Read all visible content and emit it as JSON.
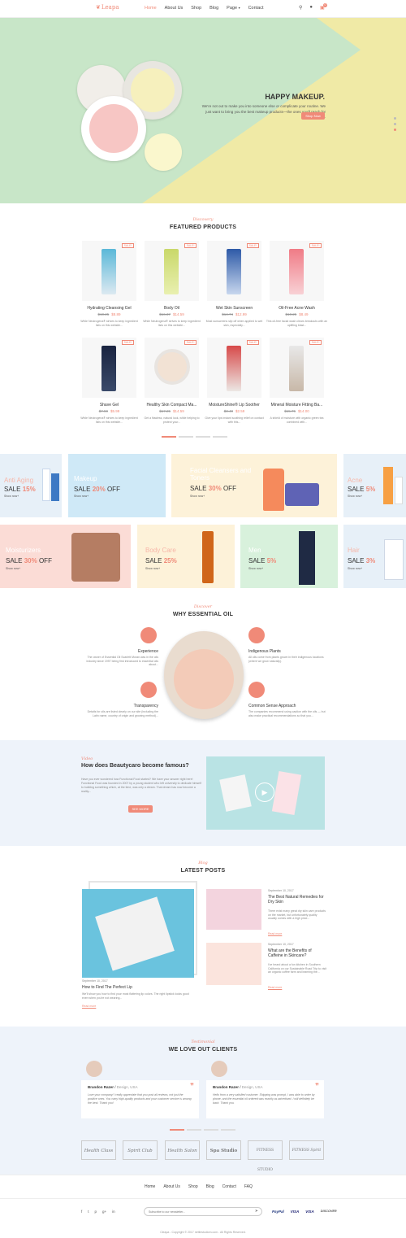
{
  "header": {
    "logo": "Leapa",
    "nav": [
      "Home",
      "About Us",
      "Shop",
      "Blog",
      "Page",
      "Contact"
    ],
    "cart_count": "0"
  },
  "hero": {
    "title": "HAPPY MAKEUP.",
    "text": "We're not out to make you into someone else or complicate your routine. We just want to bring you the best makeup products—the ones you'll reach for every day.",
    "button": "Shop Now"
  },
  "featured": {
    "script": "Discovery",
    "title": "FEATURED PRODUCTS",
    "products": [
      {
        "name": "Hydrating Cleansing Gel",
        "old": "$10.25",
        "price": "$8.89",
        "desc": "While Neutrogena® strives to keep ingredient lists on this website...",
        "sale": "SALE!"
      },
      {
        "name": "Body Oil",
        "old": "$16.37",
        "price": "$14.59",
        "desc": "While Neutrogena® strives to keep ingredient lists on this website...",
        "sale": "SALE!"
      },
      {
        "name": "Wet Skin Sunscreen",
        "old": "$14.74",
        "price": "$12.99",
        "desc": "Most sunscreens slip off when applied to wet skin, especially...",
        "sale": "SALE!"
      },
      {
        "name": "Oil-Free Acne Wash",
        "old": "$10.25",
        "price": "$8.49",
        "desc": "This oil-free facial wash clears breakouts with an uplifting blast...",
        "sale": "SALE!"
      },
      {
        "name": "Shave Gel",
        "old": "$7.59",
        "price": "$5.99",
        "desc": "While Neutrogena® strives to keep ingredient lists on this website...",
        "sale": "SALE!"
      },
      {
        "name": "Healthy Skin Compact Ma...",
        "old": "$17.25",
        "price": "$14.59",
        "desc": "Get a flawless, natural look, while helping to protect your...",
        "sale": "SALE!"
      },
      {
        "name": "MoistureShine® Lip Soother",
        "old": "$3.40",
        "price": "$2.59",
        "desc": "Give your lips instant soothing relief on contact with this...",
        "sale": "SALE!"
      },
      {
        "name": "Mineral Moisture Fitting Ba...",
        "old": "$15.75",
        "price": "$14.00",
        "desc": "A shield of moisture with organic green tea combined with...",
        "sale": "SALE!"
      }
    ]
  },
  "banners": {
    "anti_aging": {
      "cat": "Anti Aging",
      "sale": "SALE",
      "pct": "15%",
      "shop": "Show now+"
    },
    "makeup": {
      "cat": "Makeup",
      "sale": "SALE",
      "pct": "20%",
      "off": "OFF",
      "shop": "Show now+"
    },
    "facial": {
      "cat": "Facial Cleansers and Toners",
      "sale": "SALE",
      "pct": "30%",
      "off": "OFF",
      "shop": "Show now+"
    },
    "acne": {
      "cat": "Acne",
      "sale": "SALE",
      "pct": "5%",
      "shop": "Show now+"
    },
    "moist": {
      "cat": "Moisturizers",
      "sale": "SALE",
      "pct": "30%",
      "off": "OFF",
      "shop": "Show now+"
    },
    "body": {
      "cat": "Body Care",
      "sale": "SALE",
      "pct": "25%",
      "shop": "Show now+"
    },
    "men": {
      "cat": "Men",
      "sale": "SALE",
      "pct": "5%",
      "shop": "Show now+"
    },
    "hair": {
      "cat": "Hair",
      "sale": "SALE",
      "pct": "3%",
      "shop": "Show now+"
    }
  },
  "why": {
    "script": "Discover",
    "title": "WHY ESSENTIAL OIL",
    "items": [
      {
        "t": "Experience",
        "d": "The owner of Essential Oil Scarlett Moran was in the oils industry since 1997 being first introduced to essential oils about..."
      },
      {
        "t": "Indigenous Plants",
        "d": "All oils come from plants grown in their indigenous locations (where we grow naturally)."
      },
      {
        "t": "Transparency",
        "d": "Details for oils are listed clearly on our site (including the Latin name, country of origin and growing method)..."
      },
      {
        "t": "Common Sense Approach",
        "d": "The companies recommend using caution with the oils — but also make practical recommendations so that you..."
      }
    ]
  },
  "video": {
    "script": "Video",
    "title": "How does Beautycaro become famous?",
    "text": "Have you ever wondered how Functional Food started? We have your answer right here! Functional Food was founded in 2007 by a young student who left university to dedicate himself to building something which, at the time, was only a dream. That dream has now become a reality...",
    "button": "SEE MORE"
  },
  "blog": {
    "script": "Blog",
    "title": "LATEST POSTS",
    "main": {
      "date": "September 10, 2017",
      "title": "How to Find The Perfect Lip",
      "text": "We'll show you how to find your most flattering lip colors. The right lipstick looks good even when you're not wearing...",
      "more": "Read more"
    },
    "side": [
      {
        "date": "September 10, 2017",
        "title": "The Best Natural Remedies for Dry Skin",
        "text": "There exist many great dry skin care products on the market, but unfortunately quality usually comes with a high price...",
        "more": "Read more"
      },
      {
        "date": "September 10, 2017",
        "title": "What are the Benefits of Caffeine in Skincare?",
        "text": "I've heard about a fun kitchen in Southern California on our Sustainable Road Trip to visit an organic coffee farm and learning the...",
        "more": "Read more"
      }
    ]
  },
  "testimonials": {
    "script": "Testimonial",
    "title": "WE LOVE OUT CLIENTS",
    "items": [
      {
        "name": "Brandon Razer",
        "role": "Design, USA",
        "text": "Love your company! I really appreciate that you post all reviews, not just the positive ones. You carry high-quality products and your customer service is among the best. Thank you!"
      },
      {
        "name": "Brandon Razer",
        "role": "Design, USA",
        "text": "Hello from a very satisfied customer. Shipping was prompt, I was able to order by phone, and the essential oil ordered was exactly as advertised. I will definitely be back. Thank you."
      }
    ],
    "brands": [
      "Health Class",
      "Spirit Club",
      "Health Salon",
      "Spa Studio",
      "FITNESS STUDIO",
      "FITNESS Spirit"
    ]
  },
  "footer": {
    "nav": [
      "Home",
      "About Us",
      "Shop",
      "Blog",
      "Contact",
      "FAQ"
    ],
    "social": [
      "f",
      "t",
      "p",
      "g+",
      "in"
    ],
    "newsletter_placeholder": "Subscribe to our newsletter...",
    "payments": [
      "PayPal",
      "VISA",
      "VISA",
      "DISCOVER"
    ],
    "copyright": "Cleapa - Copyright © 2017 nettlestudiom.com - All Rights Reserved."
  },
  "colors": {
    "accent": "#f08a78",
    "hero_green": "#c8e6c8",
    "hero_yellow": "#f0eaa6",
    "light_blue": "#eef3fa"
  }
}
